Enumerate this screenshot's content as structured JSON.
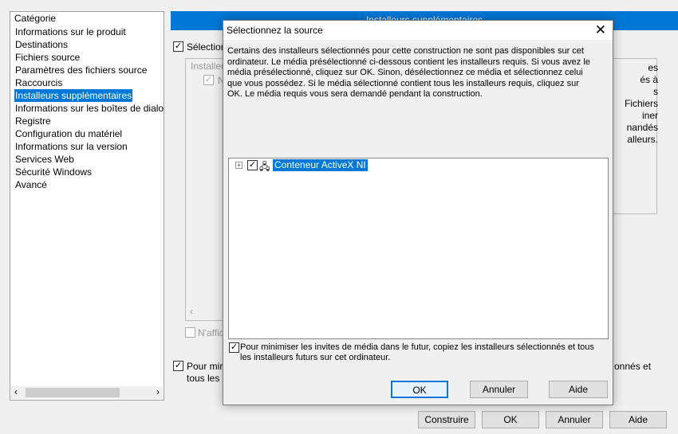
{
  "sidebar": {
    "header": "Catégorie",
    "items": [
      "Informations sur le produit",
      "Destinations",
      "Fichiers source",
      "Paramètres des fichiers source",
      "Raccourcis",
      "Installeurs supplémentaires",
      "Informations sur les boîtes de dialo",
      "Registre",
      "Configuration du matériel",
      "Informations sur la version",
      "Services Web",
      "Sécurité Windows",
      "Avancé"
    ],
    "selected_index": 5
  },
  "main": {
    "banner": "Installeurs supplémentaires",
    "select_checkbox": "Sélection",
    "list_header": "Installeu",
    "list_item": "N",
    "right_text": [
      "es",
      "és à",
      "s",
      "Fichiers",
      "iner",
      "nandés",
      "alleurs."
    ],
    "naffich": "N'affic",
    "copy_left1": "Pour mir",
    "copy_left2": "tous les i",
    "copy_right": "onnés et"
  },
  "footer": {
    "build": "Construire",
    "ok": "OK",
    "cancel": "Annuler",
    "help": "Aide"
  },
  "dialog": {
    "title": "Sélectionnez la source",
    "message": "Certains des installeurs sélectionnés pour cette construction ne sont pas disponibles sur cet ordinateur. Le média présélectionné ci-dessous contient les installeurs requis. Si vous avez le média présélectionné, cliquez sur OK. Sinon, désélectionnez ce média et sélectionnez celui que vous possédez. Si le média sélectionné contient tous les installeurs requis, cliquez sur OK. Le média requis vous sera demandé pendant la construction.",
    "tree_item": "Conteneur ActiveX NI",
    "copy_checkbox": "Pour minimiser les invites de média dans le futur, copiez les installeurs sélectionnés et tous les installeurs futurs sur cet ordinateur.",
    "ok": "OK",
    "cancel": "Annuler",
    "help": "Aide"
  },
  "colors": {
    "accent": "#0078d7"
  }
}
